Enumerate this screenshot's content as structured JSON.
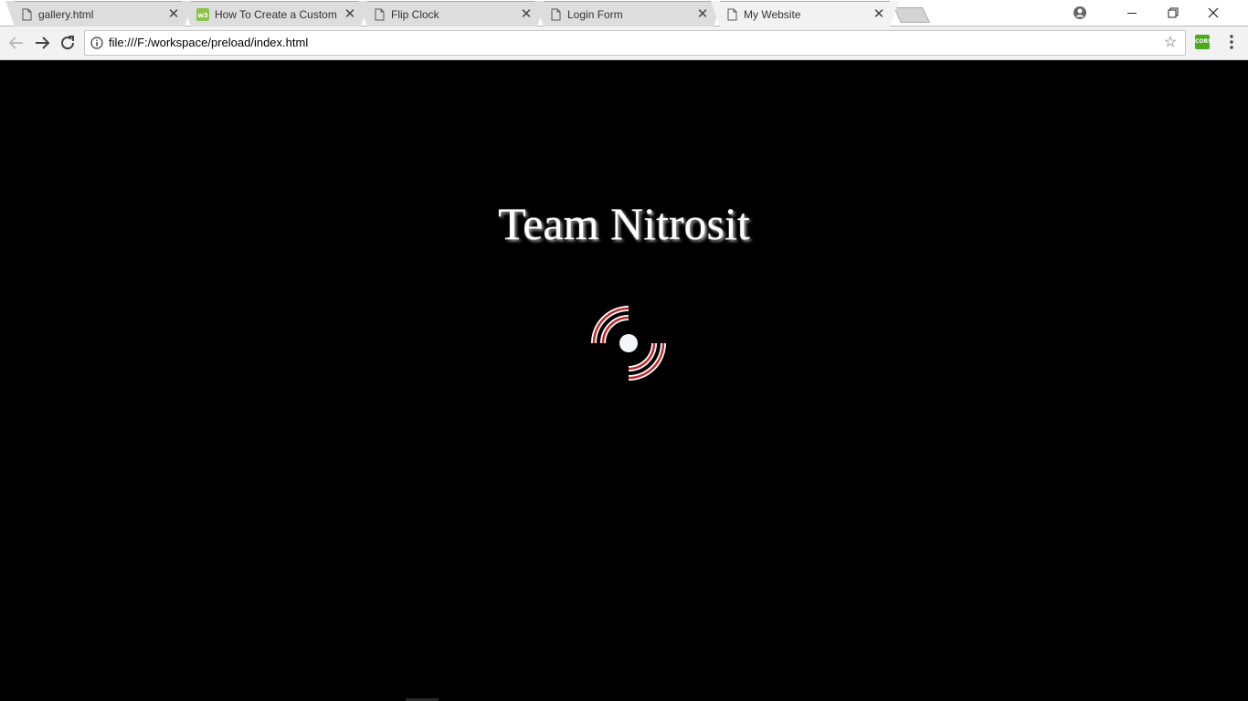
{
  "tabs": [
    {
      "title": "gallery.html",
      "icon": "page-icon",
      "active": false
    },
    {
      "title": "How To Create a Custom",
      "icon": "w3-logo-icon",
      "active": false
    },
    {
      "title": "Flip Clock",
      "icon": "page-icon",
      "active": false
    },
    {
      "title": "Login Form",
      "icon": "page-icon",
      "active": false
    },
    {
      "title": "My Website",
      "icon": "page-icon",
      "active": true
    }
  ],
  "address_bar": {
    "url": "file:///F:/workspace/preload/index.html"
  },
  "extension": {
    "label": "CORS",
    "color": "#4caa1f"
  },
  "page": {
    "heading": "Team Nitrosit",
    "background": "#000000",
    "loader_colors": {
      "ring": "#ffffff",
      "stripe": "#c1272d",
      "dot": "#f4f8fb"
    }
  }
}
